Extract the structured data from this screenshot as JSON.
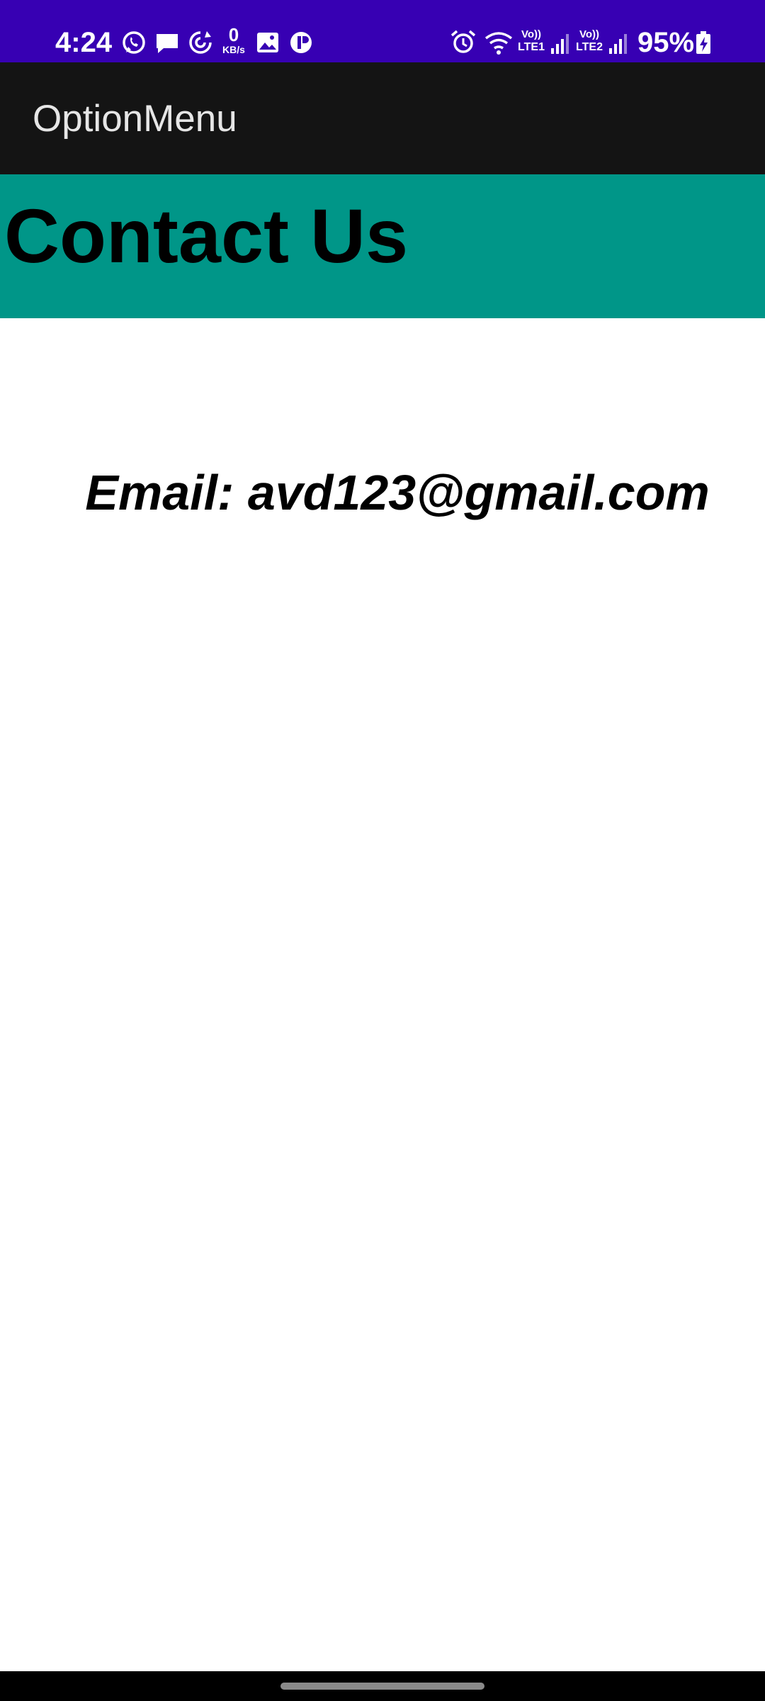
{
  "status_bar": {
    "time": "4:24",
    "network_speed_value": "0",
    "network_speed_unit": "KB/s",
    "sim1_label_top": "Vo))",
    "sim1_label_bottom": "LTE1",
    "sim2_label_top": "Vo))",
    "sim2_label_bottom": "LTE2",
    "battery_percent": "95%",
    "icons": [
      "whatsapp-icon",
      "message-icon",
      "sync-icon",
      "gallery-icon",
      "app-icon",
      "alarm-icon",
      "wifi-icon",
      "signal-icon",
      "battery-charging-icon"
    ],
    "background": "#3700b3"
  },
  "app_bar": {
    "title": "OptionMenu",
    "background": "#141414"
  },
  "main": {
    "heading": "Contact Us",
    "heading_background": "#009688",
    "email_text": "Email: avd123@gmail.com"
  }
}
